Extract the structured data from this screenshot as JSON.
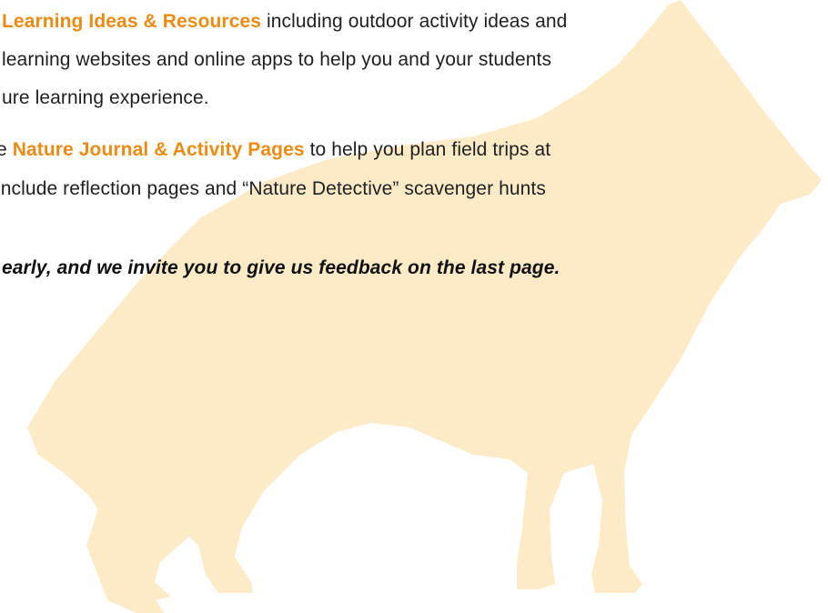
{
  "colors": {
    "highlight": "#ec8a12",
    "fox_silhouette": "#fdebc8",
    "body_text": "#1f1f1f"
  },
  "paragraph1": {
    "line1_highlight": "Learning Ideas & Resources",
    "line1_rest": " including outdoor activity ideas and",
    "line2": "learning websites and online apps to help you and your students",
    "line3": "ure learning experience."
  },
  "paragraph2": {
    "line1_prefix": "e ",
    "line1_highlight": "Nature Journal & Activity Pages",
    "line1_rest": " to help you plan field trips at",
    "line2": "include reflection pages and “Nature Detective” scavenger hunts"
  },
  "closing": "early, and we invite you to give us feedback on the last page."
}
